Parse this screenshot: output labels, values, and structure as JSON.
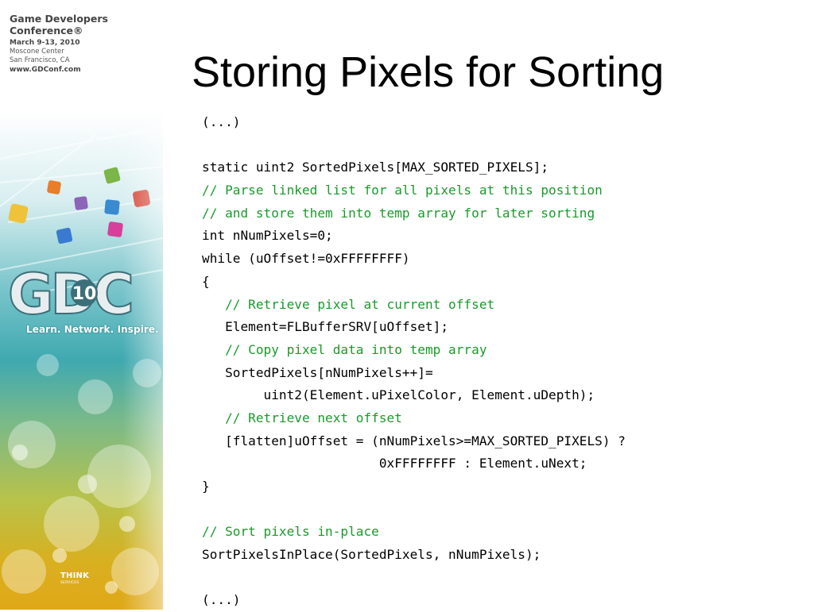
{
  "conference": {
    "name_line1": "Game Developers",
    "name_line2": "Conference®",
    "dates": "March 9-13, 2010",
    "venue": "Moscone Center",
    "city": "San Francisco, CA",
    "url": "www.GDConf.com"
  },
  "logo": {
    "letters": "GDC",
    "year": "10",
    "tagline": "Learn. Network. Inspire."
  },
  "sponsor": {
    "name": "THINK",
    "sub": "SERVICES"
  },
  "slide": {
    "title": "Storing Pixels for Sorting",
    "code_lines": [
      {
        "text": "(...)",
        "type": "code"
      },
      {
        "text": "",
        "type": "code"
      },
      {
        "text": "static uint2 SortedPixels[MAX_SORTED_PIXELS];",
        "type": "code"
      },
      {
        "text": "// Parse linked list for all pixels at this position",
        "type": "comment"
      },
      {
        "text": "// and store them into temp array for later sorting",
        "type": "comment"
      },
      {
        "text": "int nNumPixels=0;",
        "type": "code"
      },
      {
        "text": "while (uOffset!=0xFFFFFFFF)",
        "type": "code"
      },
      {
        "text": "{",
        "type": "code"
      },
      {
        "text": "   // Retrieve pixel at current offset",
        "type": "comment"
      },
      {
        "text": "   Element=FLBufferSRV[uOffset];",
        "type": "code"
      },
      {
        "text": "   // Copy pixel data into temp array",
        "type": "comment"
      },
      {
        "text": "   SortedPixels[nNumPixels++]=",
        "type": "code"
      },
      {
        "text": "        uint2(Element.uPixelColor, Element.uDepth);",
        "type": "code"
      },
      {
        "text": "   // Retrieve next offset",
        "type": "comment"
      },
      {
        "text": "   [flatten]uOffset = (nNumPixels>=MAX_SORTED_PIXELS) ?",
        "type": "code"
      },
      {
        "text": "                       0xFFFFFFFF : Element.uNext;",
        "type": "code"
      },
      {
        "text": "}",
        "type": "code"
      },
      {
        "text": "",
        "type": "code"
      },
      {
        "text": "// Sort pixels in-place",
        "type": "comment"
      },
      {
        "text": "SortPixelsInPlace(SortedPixels, nNumPixels);",
        "type": "code"
      },
      {
        "text": "",
        "type": "code"
      },
      {
        "text": "(...)",
        "type": "code"
      }
    ]
  },
  "colors": {
    "comment": "#1a9a2a",
    "code": "#000000",
    "title": "#000000"
  }
}
